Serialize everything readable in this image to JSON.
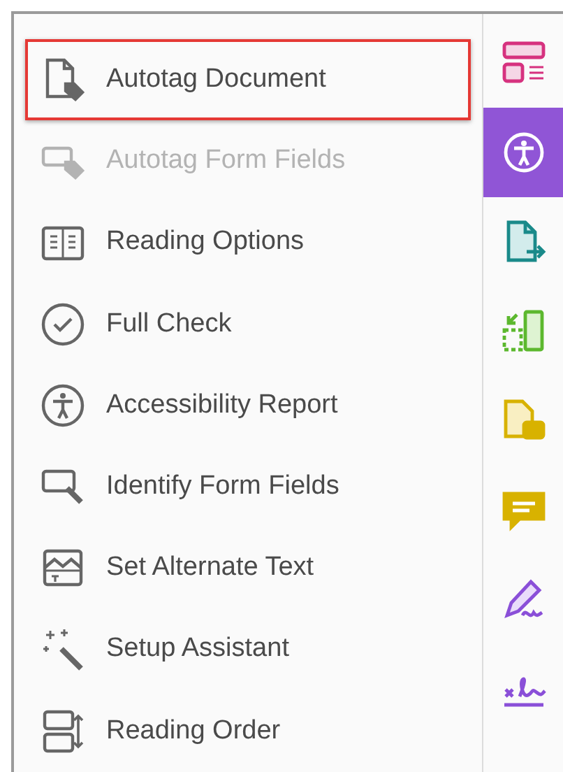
{
  "tools": [
    {
      "kind": "autotag",
      "label": "Autotag Document",
      "selected": true,
      "disabled": false
    },
    {
      "kind": "form-tag",
      "label": "Autotag Form Fields",
      "selected": false,
      "disabled": true
    },
    {
      "kind": "book",
      "label": "Reading Options",
      "selected": false,
      "disabled": false
    },
    {
      "kind": "check",
      "label": "Full Check",
      "selected": false,
      "disabled": false
    },
    {
      "kind": "access",
      "label": "Accessibility Report",
      "selected": false,
      "disabled": false
    },
    {
      "kind": "identify",
      "label": "Identify Form Fields",
      "selected": false,
      "disabled": false
    },
    {
      "kind": "alt",
      "label": "Set Alternate Text",
      "selected": false,
      "disabled": false
    },
    {
      "kind": "wand",
      "label": "Setup Assistant",
      "selected": false,
      "disabled": false
    },
    {
      "kind": "order",
      "label": "Reading Order",
      "selected": false,
      "disabled": false
    }
  ],
  "rail": [
    {
      "kind": "layout",
      "selected": false
    },
    {
      "kind": "access",
      "selected": true
    },
    {
      "kind": "export",
      "selected": false
    },
    {
      "kind": "organize",
      "selected": false
    },
    {
      "kind": "doc-comment",
      "selected": false
    },
    {
      "kind": "comment",
      "selected": false
    },
    {
      "kind": "sign",
      "selected": false
    },
    {
      "kind": "fill-sign",
      "selected": false
    }
  ]
}
